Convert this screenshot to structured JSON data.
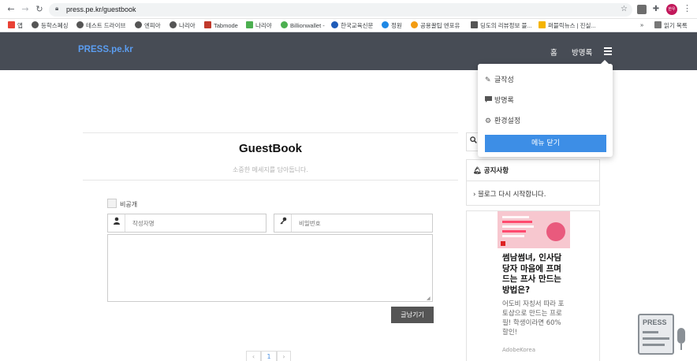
{
  "browser": {
    "url": "press.pe.kr/guestbook",
    "profile_label": "한우",
    "reading_list_label": "읽기 목록",
    "bookmarks": [
      {
        "label": "앱",
        "color": "#e94235"
      },
      {
        "label": "등학스폐싱",
        "color": "#555555"
      },
      {
        "label": "테스트 드라이브",
        "color": "#555555"
      },
      {
        "label": "엔피아",
        "color": "#555555"
      },
      {
        "label": "나리아",
        "color": "#555555"
      },
      {
        "label": "Tabmode",
        "color": "#c0392b"
      },
      {
        "label": "나리야",
        "color": "#4caf50"
      },
      {
        "label": "Billionwallet -",
        "color": "#4caf50"
      },
      {
        "label": "한국교육신문",
        "color": "#1e5bb8"
      },
      {
        "label": "정원",
        "color": "#1e88e5"
      },
      {
        "label": "공용꿀팁 엔포유",
        "color": "#f39c12"
      },
      {
        "label": "딩도의 리뷰정보 블...",
        "color": "#555555"
      },
      {
        "label": "퍼블릭뉴스 | 진실...",
        "color": "#f5b400"
      }
    ]
  },
  "header": {
    "brand": "PRESS.pe.kr",
    "nav": {
      "home": "홈",
      "guestbook": "방명록"
    }
  },
  "dropdown": {
    "items": [
      {
        "label": "글작성",
        "icon": "pencil-icon"
      },
      {
        "label": "방명록",
        "icon": "comment-icon"
      },
      {
        "label": "환경설정",
        "icon": "gear-icon"
      }
    ],
    "close_label": "메뉴 닫기"
  },
  "guestbook": {
    "title": "GuestBook",
    "subtitle": "소중한 메세지를 담아둡니다.",
    "private_label": "비공개",
    "name_placeholder": "작성자명",
    "password_placeholder": "비밀번호",
    "submit_label": "글남기기",
    "pager": [
      "‹",
      "1",
      "›"
    ]
  },
  "sidebar": {
    "notice_title": "공지사항",
    "notice_item": "블로그 다시 시작합니다.",
    "ad": {
      "title": "썸남썸녀, 인사담당자 마음에 프며드는 프사 만드는 방법은?",
      "desc": "어도비 자칭서 따라 포토샵으로 만드는 프로필! 학생이라면 60% 할인!",
      "source": "AdobeKorea"
    }
  },
  "widget": {
    "label": "PRESS"
  }
}
